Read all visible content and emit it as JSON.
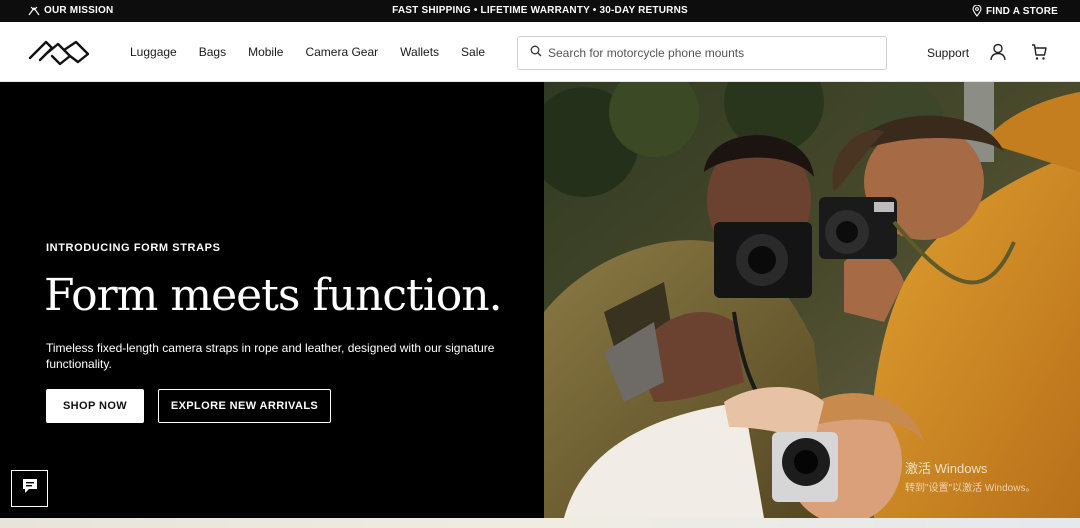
{
  "topbar": {
    "mission": "OUR MISSION",
    "promo": "FAST SHIPPING • LIFETIME WARRANTY • 30-DAY RETURNS",
    "store": "FIND A STORE"
  },
  "nav": {
    "items": [
      "Luggage",
      "Bags",
      "Mobile",
      "Camera Gear",
      "Wallets",
      "Sale"
    ],
    "search_placeholder": "Search for motorcycle phone mounts",
    "support": "Support"
  },
  "hero": {
    "eyebrow": "INTRODUCING FORM STRAPS",
    "headline": "Form meets function.",
    "description": "Timeless fixed-length camera straps in rope and leather, designed with our signature functionality.",
    "primary_cta": "SHOP NOW",
    "secondary_cta": "EXPLORE NEW ARRIVALS"
  },
  "os_watermark": {
    "line1": "激活 Windows",
    "line2": "转到\"设置\"以激活 Windows。"
  },
  "colors": {
    "topbar_bg": "#0d0d0d",
    "hero_left_bg": "#000000",
    "jacket_orange": "#c9861e",
    "jacket_olive": "#6b5a2e"
  },
  "icons": [
    "mission-icon",
    "location-pin-icon",
    "logo-mark",
    "search-icon",
    "account-icon",
    "cart-icon",
    "chat-icon"
  ]
}
